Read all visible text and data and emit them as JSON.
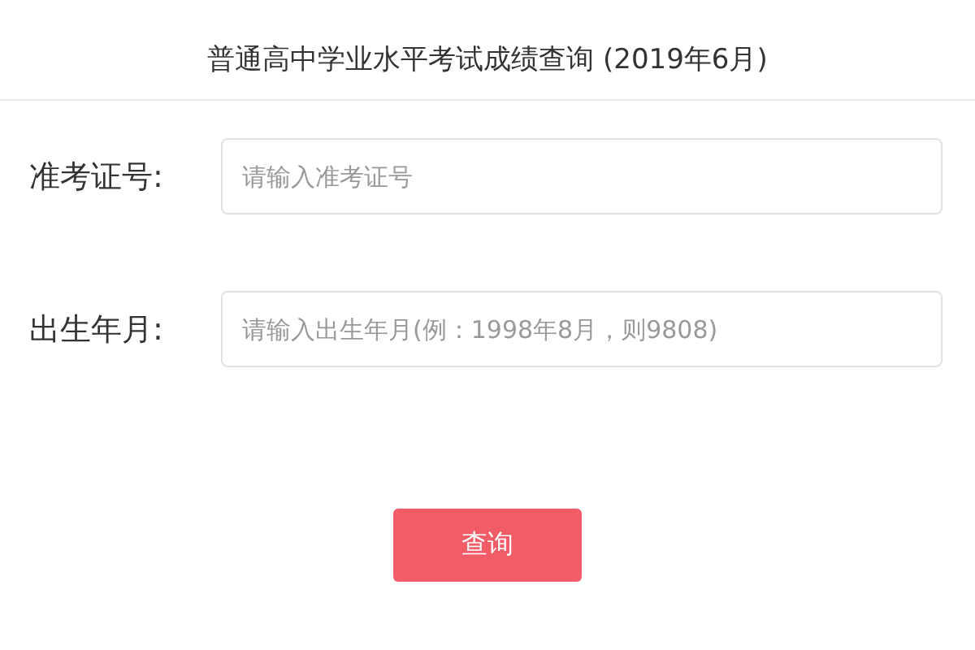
{
  "title": "普通高中学业水平考试成绩查询 (2019年6月)",
  "fields": [
    {
      "label": "准考证号:",
      "placeholder": "请输入准考证号"
    },
    {
      "label": "出生年月:",
      "placeholder": "请输入出生年月(例：1998年8月，则9808)"
    }
  ],
  "button": "查询"
}
